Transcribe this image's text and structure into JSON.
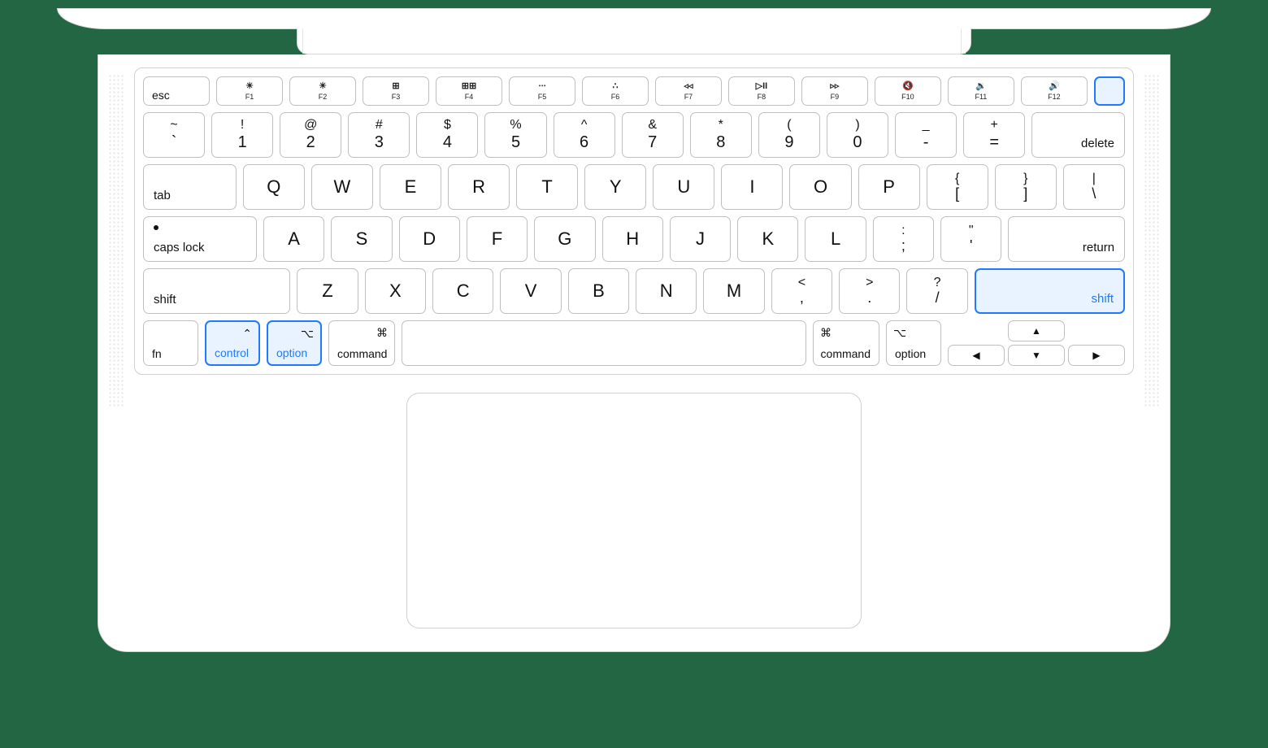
{
  "highlighted_keys": [
    "power",
    "right-shift",
    "left-control",
    "left-option"
  ],
  "fn_row": {
    "esc": "esc",
    "keys": [
      {
        "id": "F1",
        "icon": "☀︎",
        "label": "F1"
      },
      {
        "id": "F2",
        "icon": "☀",
        "label": "F2"
      },
      {
        "id": "F3",
        "icon": "⊞",
        "label": "F3"
      },
      {
        "id": "F4",
        "icon": "⊞⊞",
        "label": "F4"
      },
      {
        "id": "F5",
        "icon": "∙∙∙",
        "label": "F5"
      },
      {
        "id": "F6",
        "icon": "∴",
        "label": "F6"
      },
      {
        "id": "F7",
        "icon": "◃◃",
        "label": "F7"
      },
      {
        "id": "F8",
        "icon": "▷II",
        "label": "F8"
      },
      {
        "id": "F9",
        "icon": "▹▹",
        "label": "F9"
      },
      {
        "id": "F10",
        "icon": "🔇",
        "label": "F10"
      },
      {
        "id": "F11",
        "icon": "🔉",
        "label": "F11"
      },
      {
        "id": "F12",
        "icon": "🔊",
        "label": "F12"
      }
    ]
  },
  "num_row": [
    {
      "upper": "~",
      "lower": "`"
    },
    {
      "upper": "!",
      "lower": "1"
    },
    {
      "upper": "@",
      "lower": "2"
    },
    {
      "upper": "#",
      "lower": "3"
    },
    {
      "upper": "$",
      "lower": "4"
    },
    {
      "upper": "%",
      "lower": "5"
    },
    {
      "upper": "^",
      "lower": "6"
    },
    {
      "upper": "&",
      "lower": "7"
    },
    {
      "upper": "*",
      "lower": "8"
    },
    {
      "upper": "(",
      "lower": "9"
    },
    {
      "upper": ")",
      "lower": "0"
    },
    {
      "upper": "_",
      "lower": "-"
    },
    {
      "upper": "+",
      "lower": "="
    }
  ],
  "delete": "delete",
  "tab": "tab",
  "q_row": [
    "Q",
    "W",
    "E",
    "R",
    "T",
    "Y",
    "U",
    "I",
    "O",
    "P"
  ],
  "q_tail": [
    {
      "upper": "{",
      "lower": "["
    },
    {
      "upper": "}",
      "lower": "]"
    },
    {
      "upper": "|",
      "lower": "\\"
    }
  ],
  "caps": "caps lock",
  "a_row": [
    "A",
    "S",
    "D",
    "F",
    "G",
    "H",
    "J",
    "K",
    "L"
  ],
  "a_tail": [
    {
      "upper": ":",
      "lower": ";"
    },
    {
      "upper": "\"",
      "lower": "'"
    }
  ],
  "return": "return",
  "lshift": "shift",
  "z_row": [
    "Z",
    "X",
    "C",
    "V",
    "B",
    "N",
    "M"
  ],
  "z_tail": [
    {
      "upper": "<",
      "lower": ","
    },
    {
      "upper": ">",
      "lower": "."
    },
    {
      "upper": "?",
      "lower": "/"
    }
  ],
  "rshift": "shift",
  "mods": {
    "fn": "fn",
    "control": {
      "sym": "⌃",
      "label": "control"
    },
    "option": {
      "sym": "⌥",
      "label": "option"
    },
    "command": {
      "sym": "⌘",
      "label": "command"
    }
  },
  "arrows": {
    "up": "▲",
    "down": "▼",
    "left": "◀",
    "right": "▶"
  }
}
